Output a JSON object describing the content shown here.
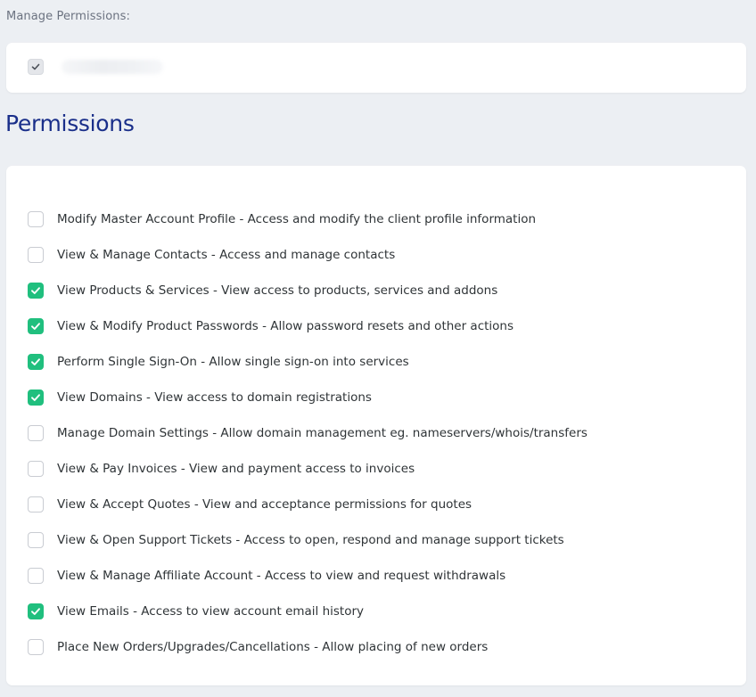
{
  "manage": {
    "label": "Manage Permissions:",
    "all_checked": true,
    "user_name": ""
  },
  "section_title": "Permissions",
  "colors": {
    "accent_green": "#20bf7e",
    "title_blue": "#1a2f8a",
    "background": "#eceff3"
  },
  "permissions": [
    {
      "label": "Modify Master Account Profile - Access and modify the client profile information",
      "checked": false
    },
    {
      "label": "View & Manage Contacts - Access and manage contacts",
      "checked": false
    },
    {
      "label": "View Products & Services - View access to products, services and addons",
      "checked": true
    },
    {
      "label": "View & Modify Product Passwords - Allow password resets and other actions",
      "checked": true
    },
    {
      "label": "Perform Single Sign-On - Allow single sign-on into services",
      "checked": true
    },
    {
      "label": "View Domains - View access to domain registrations",
      "checked": true
    },
    {
      "label": "Manage Domain Settings - Allow domain management eg. nameservers/whois/transfers",
      "checked": false
    },
    {
      "label": "View & Pay Invoices - View and payment access to invoices",
      "checked": false
    },
    {
      "label": "View & Accept Quotes - View and acceptance permissions for quotes",
      "checked": false
    },
    {
      "label": "View & Open Support Tickets - Access to open, respond and manage support tickets",
      "checked": false
    },
    {
      "label": "View & Manage Affiliate Account - Access to view and request withdrawals",
      "checked": false
    },
    {
      "label": "View Emails - Access to view account email history",
      "checked": true
    },
    {
      "label": "Place New Orders/Upgrades/Cancellations - Allow placing of new orders",
      "checked": false
    }
  ]
}
